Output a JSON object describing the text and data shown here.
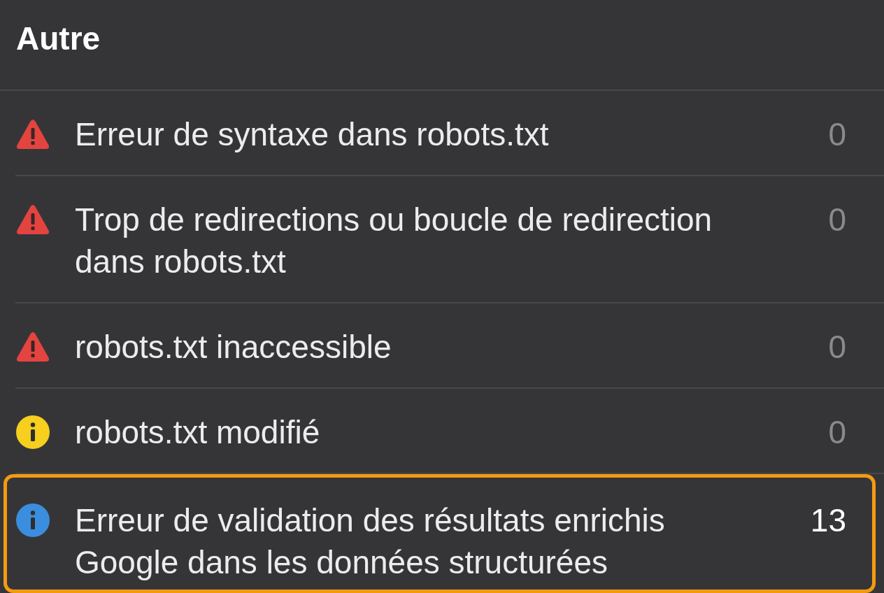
{
  "section": {
    "title": "Autre"
  },
  "items": [
    {
      "kind": "error",
      "label": "Erreur de syntaxe dans robots.txt",
      "count": "0",
      "has_issues": false,
      "selected": false
    },
    {
      "kind": "error",
      "label": "Trop de redirections ou boucle de redirection dans robots.txt",
      "count": "0",
      "has_issues": false,
      "selected": false
    },
    {
      "kind": "error",
      "label": "robots.txt inaccessible",
      "count": "0",
      "has_issues": false,
      "selected": false
    },
    {
      "kind": "warning",
      "label": "robots.txt modifié",
      "count": "0",
      "has_issues": false,
      "selected": false
    },
    {
      "kind": "info",
      "label": "Erreur de validation des résultats enrichis Google dans les données structurées",
      "count": "13",
      "has_issues": true,
      "selected": true
    }
  ]
}
